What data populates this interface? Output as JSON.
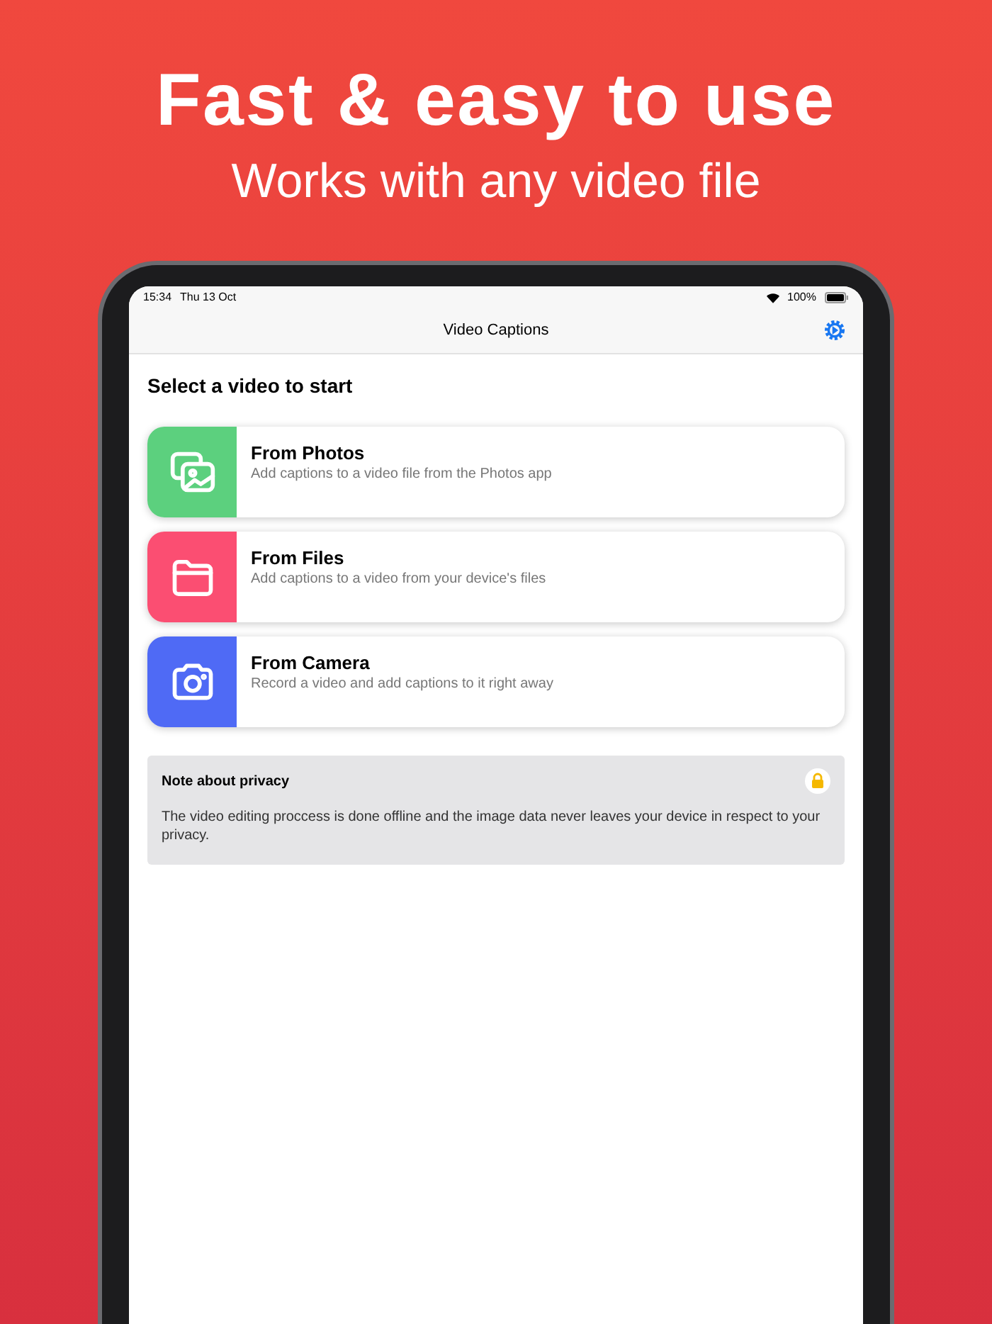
{
  "headline": "Fast & easy to use",
  "subheadline": "Works with any video file",
  "status_bar": {
    "time": "15:34",
    "date": "Thu 13 Oct",
    "battery": "100%"
  },
  "nav_bar": {
    "title": "Video Captions"
  },
  "section_title": "Select a video to start",
  "sources": [
    {
      "kind": "photos",
      "title": "From Photos",
      "description": "Add captions to a video file from the Photos app",
      "color": "#5cd07e"
    },
    {
      "kind": "files",
      "title": "From Files",
      "description": "Add captions to a video from your device's files",
      "color": "#fb4e72"
    },
    {
      "kind": "camera",
      "title": "From Camera",
      "description": "Record a video and add captions to it right away",
      "color": "#4f6af5"
    }
  ],
  "privacy_note": {
    "title": "Note about privacy",
    "text": "The video editing proccess is done offline and the image data never leaves your device in respect to your privacy."
  }
}
